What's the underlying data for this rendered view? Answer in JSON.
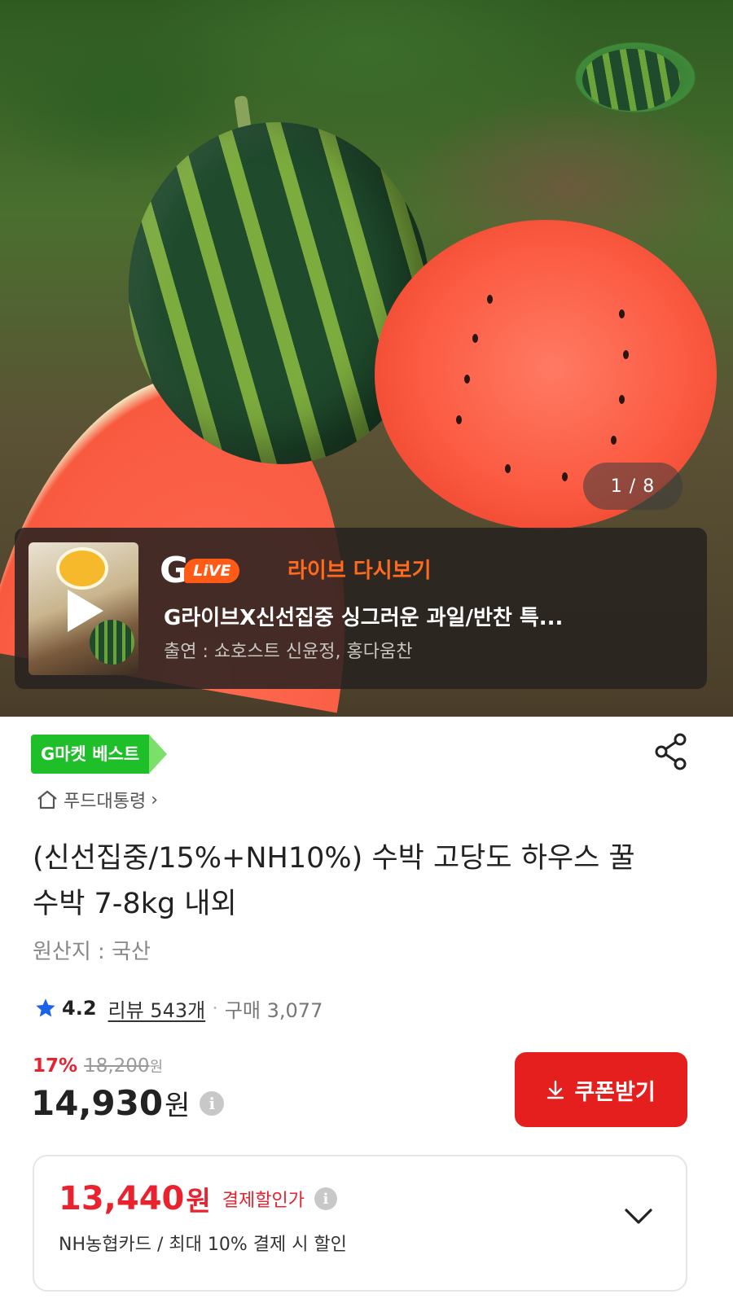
{
  "hero": {
    "image_counter": "1 / 8"
  },
  "live": {
    "g_letter": "G",
    "live_badge": "LiVE",
    "replay_label": "라이브 다시보기",
    "title": "G라이브X신선집중 싱그러운 과일/반찬 특...",
    "cast": "출연 : 쇼호스트 신윤정, 홍다움찬"
  },
  "product": {
    "badge": "G마켓 베스트",
    "breadcrumb": "푸드대통령",
    "title": "(신선집중/15%+NH10%) 수박 고당도 하우스 꿀수박 7-8kg 내외",
    "origin": "원산지 : 국산",
    "rating": "4.2",
    "review_label": "리뷰 543개",
    "purchase_label": "구매 3,077",
    "discount_pct": "17%",
    "original_price": "18,200",
    "original_unit": "원",
    "price": "14,930",
    "price_unit": "원",
    "coupon_label": "쿠폰받기"
  },
  "card": {
    "price": "13,440",
    "unit": "원",
    "label": "결제할인가",
    "sub": "NH농협카드 / 최대 10% 결제 시 할인"
  },
  "colors": {
    "accent_red": "#e51e1e",
    "best_green": "#1fbf2a",
    "live_orange": "#ff5b17"
  },
  "icons": [
    "play-icon",
    "share-icon",
    "home-icon",
    "star-icon",
    "info-icon",
    "download-icon",
    "chevron-down-icon"
  ]
}
